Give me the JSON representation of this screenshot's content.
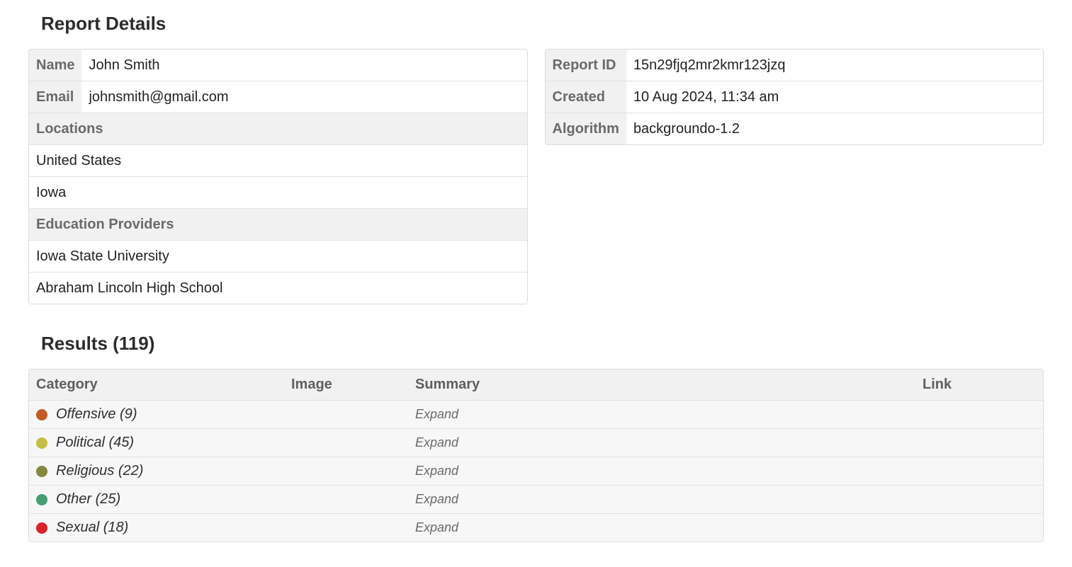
{
  "headings": {
    "report_details": "Report Details",
    "results_prefix": "Results",
    "results_count": "119"
  },
  "left_panel": {
    "labels": {
      "name": "Name",
      "email": "Email",
      "locations": "Locations",
      "education": "Education Providers"
    },
    "name": "John Smith",
    "email": "johnsmith@gmail.com",
    "locations": [
      "United States",
      "Iowa"
    ],
    "education": [
      "Iowa State University",
      "Abraham Lincoln High School"
    ]
  },
  "right_panel": {
    "labels": {
      "report_id": "Report ID",
      "created": "Created",
      "algorithm": "Algorithm"
    },
    "report_id": "15n29fjq2mr2kmr123jzq",
    "created": "10 Aug 2024, 11:34 am",
    "algorithm": "backgroundo-1.2"
  },
  "results": {
    "columns": {
      "category": "Category",
      "image": "Image",
      "summary": "Summary",
      "link": "Link"
    },
    "expand_label": "Expand",
    "rows": [
      {
        "label": "Offensive",
        "count": 9,
        "color": "#c45a23"
      },
      {
        "label": "Political",
        "count": 45,
        "color": "#c5bd47"
      },
      {
        "label": "Religious",
        "count": 22,
        "color": "#86893f"
      },
      {
        "label": "Other",
        "count": 25,
        "color": "#449e72"
      },
      {
        "label": "Sexual",
        "count": 18,
        "color": "#d8232a"
      }
    ]
  }
}
